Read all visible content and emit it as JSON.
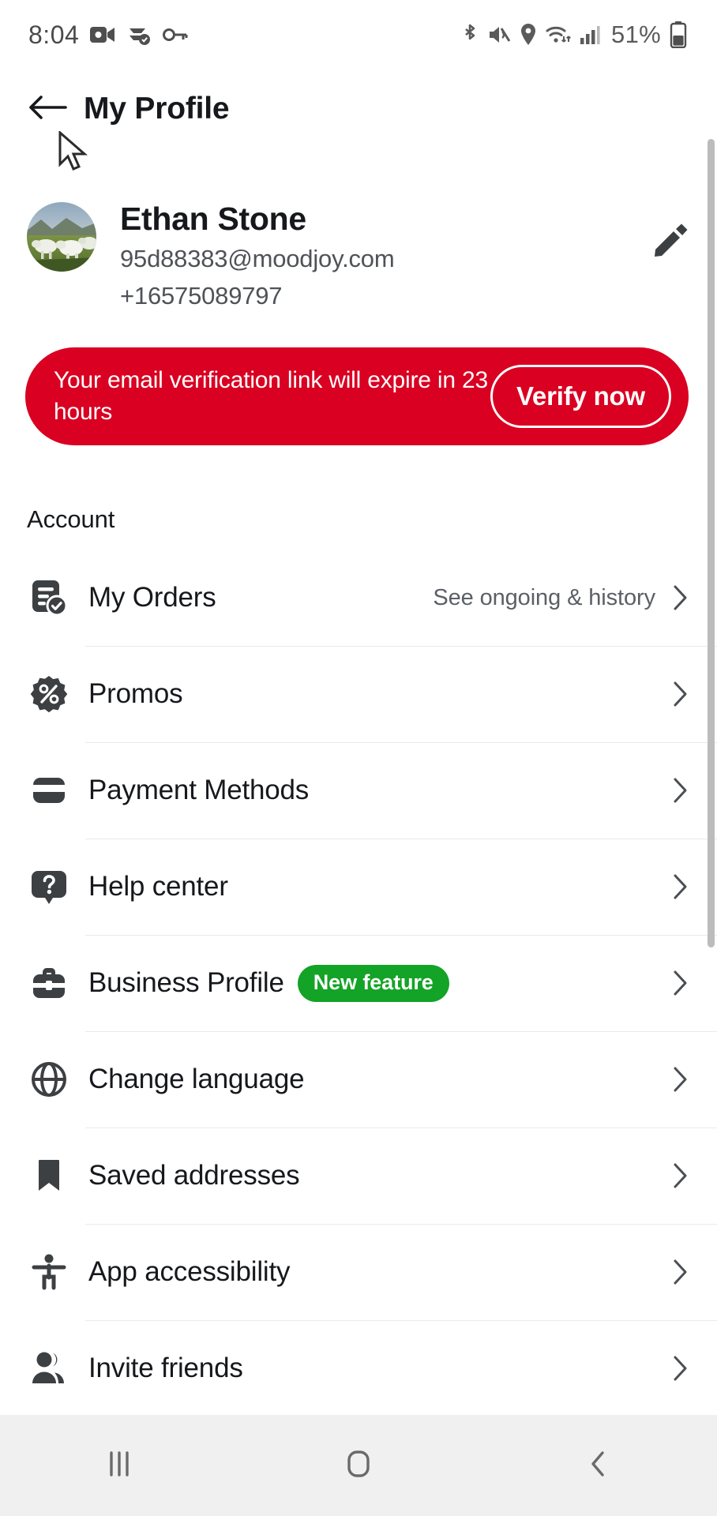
{
  "status_bar": {
    "time": "8:04",
    "battery_percent": "51%",
    "left_icons": [
      "video-camera-icon",
      "data-saver-icon",
      "vpn-key-icon"
    ],
    "right_icons": [
      "bluetooth-icon",
      "mute-icon",
      "location-icon",
      "wifi-icon",
      "signal-icon",
      "battery-icon"
    ]
  },
  "header": {
    "title": "My Profile",
    "back_icon": "arrow-left-icon"
  },
  "profile": {
    "name": "Ethan Stone",
    "email": "95d88383@moodjoy.com",
    "phone": "+16575089797",
    "avatar_alt": "sheep-in-field-photo",
    "edit_icon": "pencil-icon"
  },
  "banner": {
    "message": "Your email verification link will expire in 23 hours",
    "action_label": "Verify now",
    "background_color": "#D90021",
    "text_color": "#FFFFFF"
  },
  "section": {
    "title": "Account"
  },
  "menu": {
    "items": [
      {
        "label": "My Orders",
        "icon": "orders-icon",
        "subtitle": "See ongoing & history",
        "badge": null
      },
      {
        "label": "Promos",
        "icon": "discount-icon",
        "subtitle": null,
        "badge": null
      },
      {
        "label": "Payment Methods",
        "icon": "credit-card-icon",
        "subtitle": null,
        "badge": null
      },
      {
        "label": "Help center",
        "icon": "help-question-icon",
        "subtitle": null,
        "badge": null
      },
      {
        "label": "Business Profile",
        "icon": "briefcase-icon",
        "subtitle": null,
        "badge": "New feature"
      },
      {
        "label": "Change language",
        "icon": "globe-icon",
        "subtitle": null,
        "badge": null
      },
      {
        "label": "Saved addresses",
        "icon": "bookmark-icon",
        "subtitle": null,
        "badge": null
      },
      {
        "label": "App accessibility",
        "icon": "accessibility-icon",
        "subtitle": null,
        "badge": null
      },
      {
        "label": "Invite friends",
        "icon": "people-icon",
        "subtitle": null,
        "badge": null
      }
    ],
    "chevron_icon": "chevron-right-icon",
    "badge_color": "#13A326"
  },
  "nav_bar": {
    "recents_icon": "recents-icon",
    "home_icon": "home-icon",
    "back_icon": "back-icon"
  }
}
